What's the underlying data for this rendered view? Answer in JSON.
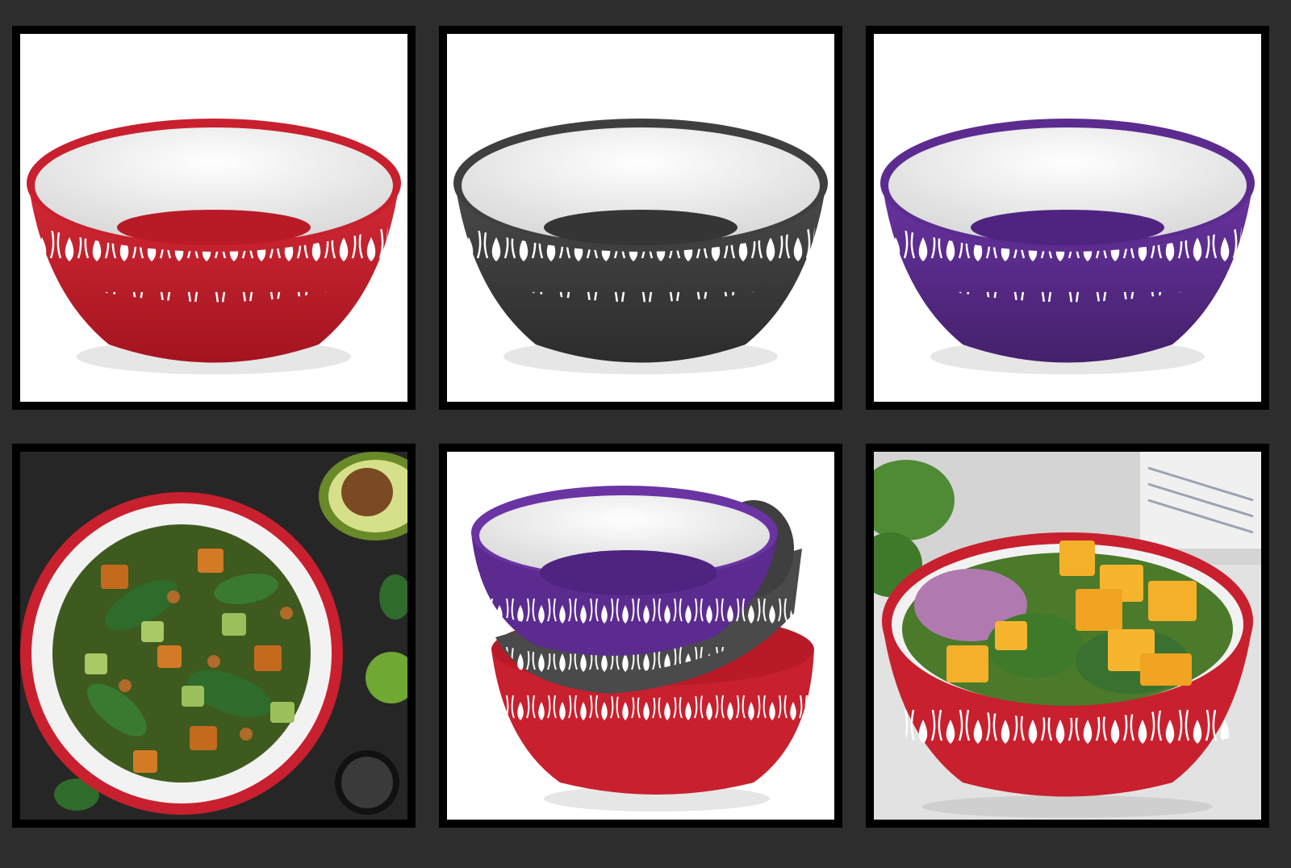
{
  "grid": {
    "tiles": [
      {
        "id": "t1",
        "subject": "red-bowl-product"
      },
      {
        "id": "t2",
        "subject": "grey-bowl-product"
      },
      {
        "id": "t3",
        "subject": "purple-bowl-product"
      },
      {
        "id": "t4",
        "subject": "salad-in-red-bowl-topdown"
      },
      {
        "id": "t5",
        "subject": "stacked-bowls"
      },
      {
        "id": "t6",
        "subject": "mango-kale-salad-in-red-bowl"
      }
    ]
  },
  "colors": {
    "background": "#2d2d2d",
    "frame": "#000000",
    "red": "#c8202e",
    "red_dark": "#a3141f",
    "grey": "#3f3f3f",
    "grey_dark": "#2c2c2c",
    "purple": "#5c2b8f",
    "purple_dark": "#44206b",
    "interior": "#ececec",
    "slate": "#2a2a2a"
  }
}
